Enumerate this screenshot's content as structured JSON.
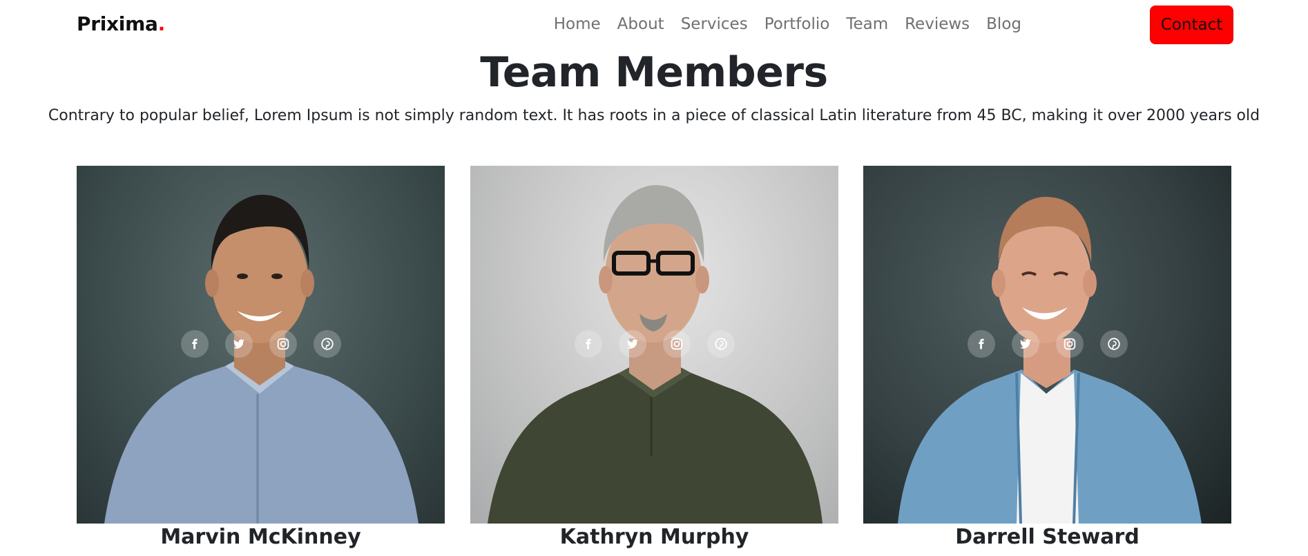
{
  "brand": {
    "name": "Priximа",
    "dot": ".",
    "accent": "#ff0000"
  },
  "nav": {
    "items": [
      "Home",
      "About",
      "Services",
      "Portfolio",
      "Team",
      "Reviews",
      "Blog"
    ],
    "contact_label": "Contact"
  },
  "section": {
    "title": "Team Members",
    "description": "Contrary to popular belief, Lorem Ipsum is not simply random text. It has roots in a piece of classical Latin literature from 45 BC, making it over 2000 years old"
  },
  "team": [
    {
      "name": "Marvin McKinney"
    },
    {
      "name": "Kathryn Murphy"
    },
    {
      "name": "Darrell Steward"
    }
  ],
  "socials": [
    "facebook-icon",
    "twitter-icon",
    "instagram-icon",
    "pinterest-icon"
  ]
}
